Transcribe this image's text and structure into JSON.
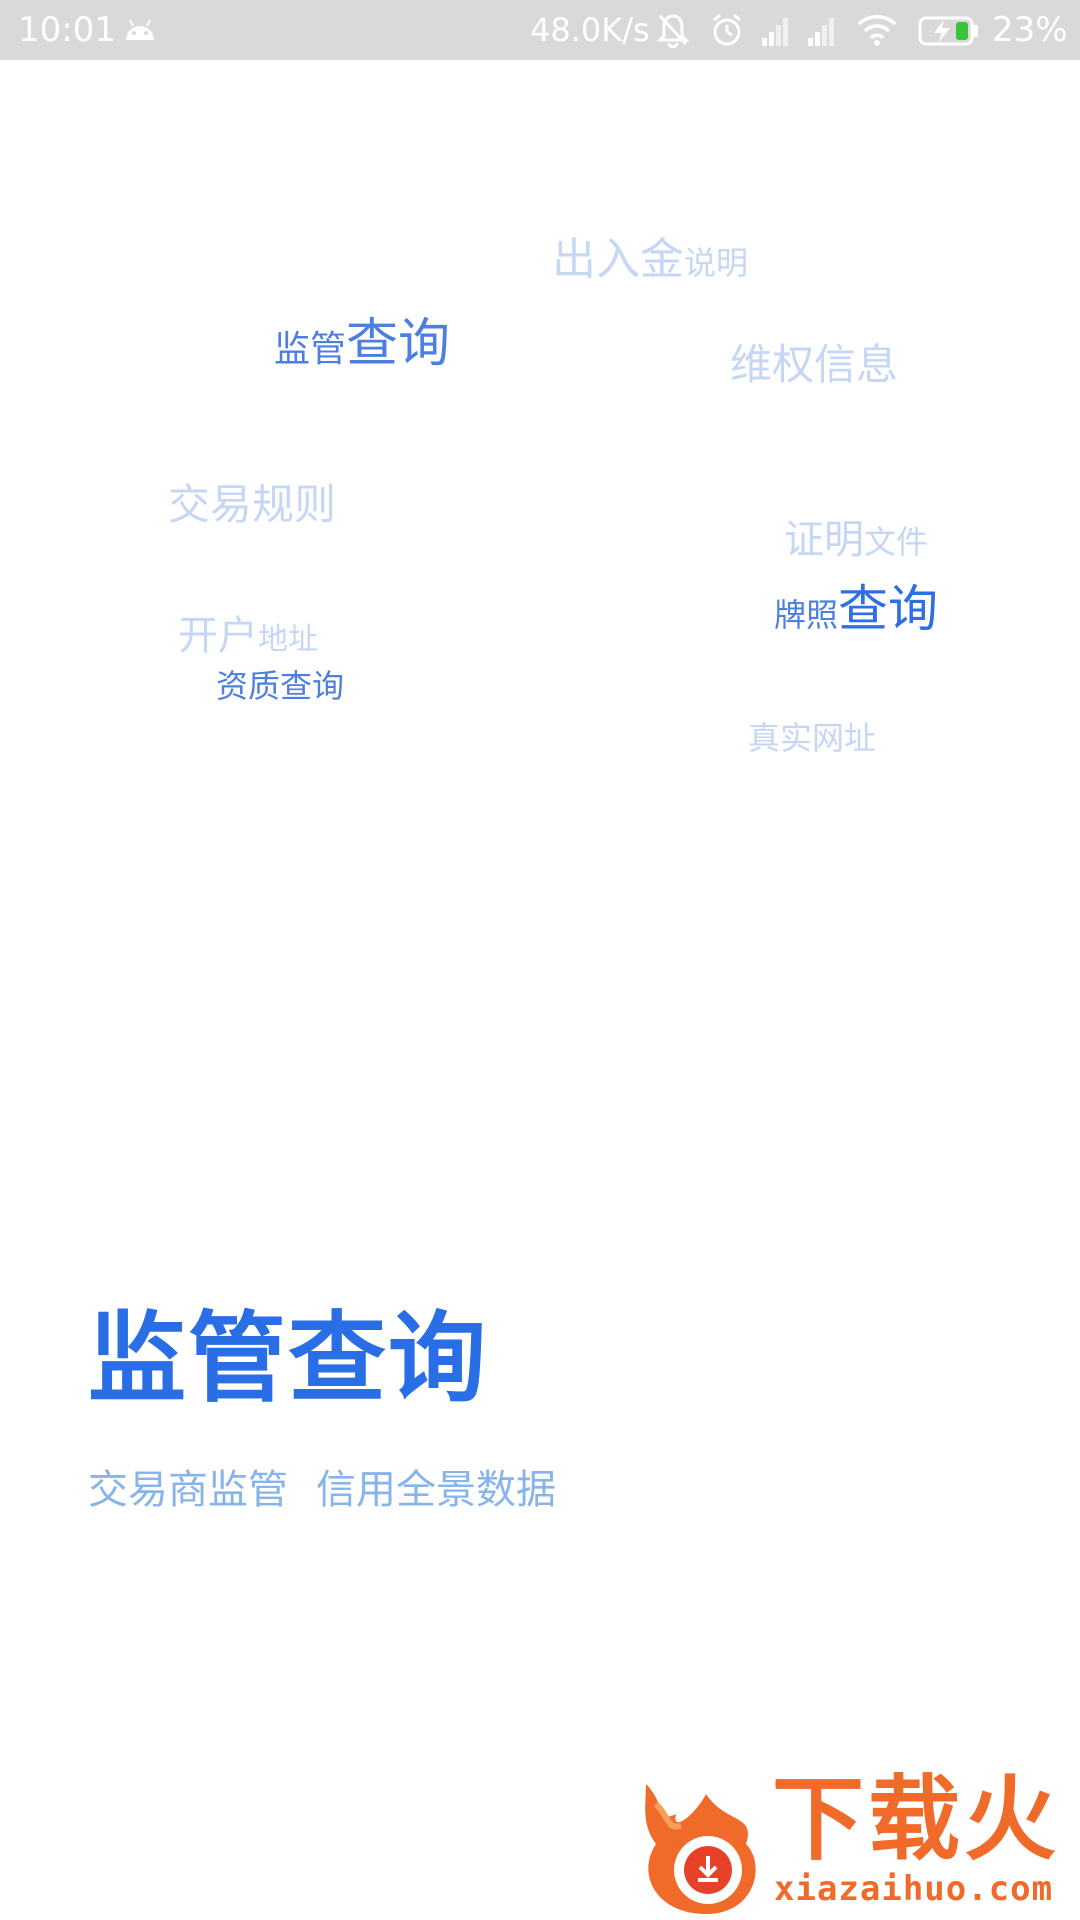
{
  "status_bar": {
    "time": "10:01",
    "net_speed": "48.0K/s",
    "battery": "23%",
    "icons": [
      "android-icon",
      "mute-bell-icon",
      "alarm-icon",
      "signal-icon",
      "signal-icon",
      "wifi-icon",
      "battery-charging-icon"
    ]
  },
  "word_cloud": {
    "items": [
      {
        "a": "出入金",
        "b": "说明"
      },
      {
        "a": "监管",
        "b": "查询"
      },
      {
        "a": "维权信息"
      },
      {
        "a": "交易规则"
      },
      {
        "a": "证明",
        "b": "文件"
      },
      {
        "a": "牌照",
        "b": "查询"
      },
      {
        "a": "开户",
        "b": "地址"
      },
      {
        "a": "资质查询"
      },
      {
        "a": "真实网址"
      }
    ]
  },
  "hero": {
    "title": "监管查询",
    "subtitle_1": "交易商监管",
    "subtitle_2": "信用全景数据"
  },
  "watermark": {
    "brand": "下载火",
    "domain": "xiazaihuo.com"
  },
  "colors": {
    "primary": "#2a6ee6",
    "faint": "#c5d7f5",
    "subtitle": "#88b4ec",
    "watermark": "#f06a2a",
    "status_bar": "#d9d9d9"
  }
}
